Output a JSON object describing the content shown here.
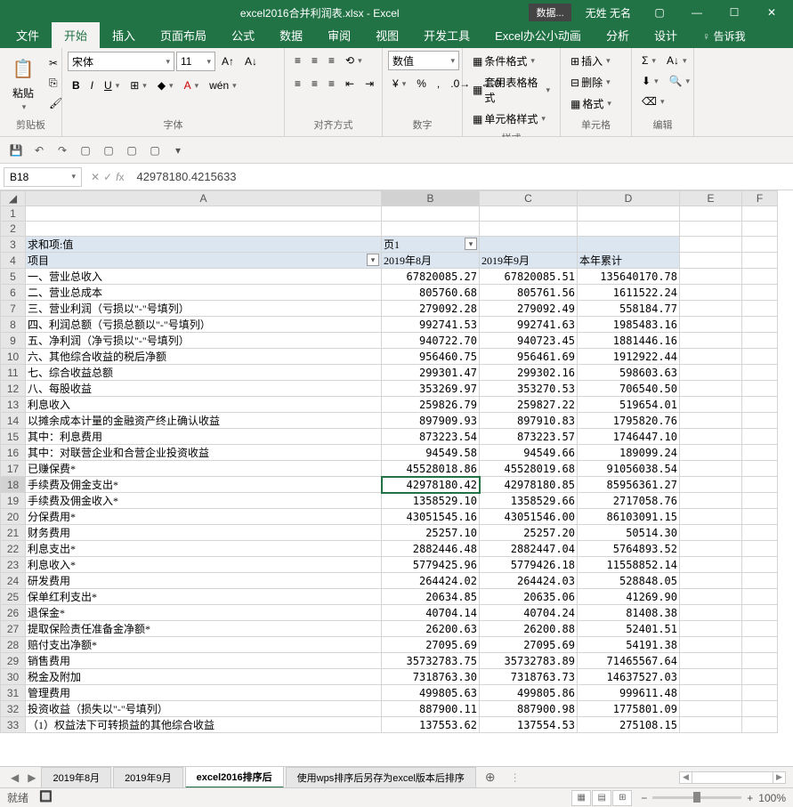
{
  "title_bar": {
    "filename": "excel2016合并利润表.xlsx - Excel",
    "data_label": "数据...",
    "user": "无姓 无名"
  },
  "menu": {
    "file": "文件",
    "home": "开始",
    "insert": "插入",
    "layout": "页面布局",
    "formula": "公式",
    "data": "数据",
    "review": "审阅",
    "view": "视图",
    "dev": "开发工具",
    "anim": "Excel办公小动画",
    "analyze": "分析",
    "design": "设计",
    "tell": "告诉我"
  },
  "ribbon": {
    "clipboard": {
      "label": "剪贴板",
      "paste": "粘贴"
    },
    "font": {
      "label": "字体",
      "name": "宋体",
      "size": "11"
    },
    "align": {
      "label": "对齐方式"
    },
    "number": {
      "label": "数字",
      "format": "数值"
    },
    "styles": {
      "label": "样式",
      "cond": "条件格式",
      "table": "套用表格格式",
      "cell": "单元格样式"
    },
    "cells": {
      "label": "单元格",
      "insert": "插入",
      "delete": "删除",
      "format": "格式"
    },
    "editing": {
      "label": "编辑"
    }
  },
  "name_box": "B18",
  "formula": "42978180.4215633",
  "cols": [
    "A",
    "B",
    "C",
    "D",
    "E",
    "F"
  ],
  "pivot": {
    "measure": "求和项:值",
    "page": "页1",
    "rowlabel": "项目",
    "col1": "2019年8月",
    "col2": "2019年9月",
    "col3": "本年累计"
  },
  "rows": [
    {
      "r": 5,
      "a": "一、营业总收入",
      "b": "67820085.27",
      "c": "67820085.51",
      "d": "135640170.78"
    },
    {
      "r": 6,
      "a": "二、营业总成本",
      "b": "805760.68",
      "c": "805761.56",
      "d": "1611522.24"
    },
    {
      "r": 7,
      "a": "三、营业利润（亏损以\"-\"号填列）",
      "b": "279092.28",
      "c": "279092.49",
      "d": "558184.77"
    },
    {
      "r": 8,
      "a": "四、利润总额（亏损总额以\"-\"号填列）",
      "b": "992741.53",
      "c": "992741.63",
      "d": "1985483.16"
    },
    {
      "r": 9,
      "a": "五、净利润（净亏损以\"-\"号填列）",
      "b": "940722.70",
      "c": "940723.45",
      "d": "1881446.16"
    },
    {
      "r": 10,
      "a": "六、其他综合收益的税后净额",
      "b": "956460.75",
      "c": "956461.69",
      "d": "1912922.44"
    },
    {
      "r": 11,
      "a": "七、综合收益总额",
      "b": "299301.47",
      "c": "299302.16",
      "d": "598603.63"
    },
    {
      "r": 12,
      "a": "八、每股收益",
      "b": "353269.97",
      "c": "353270.53",
      "d": "706540.50"
    },
    {
      "r": 13,
      "a": "                利息收入",
      "b": "259826.79",
      "c": "259827.22",
      "d": "519654.01"
    },
    {
      "r": 14,
      "a": "                以摊余成本计量的金融资产终止确认收益",
      "b": "897909.93",
      "c": "897910.83",
      "d": "1795820.76"
    },
    {
      "r": 15,
      "a": "          其中：利息费用",
      "b": "873223.54",
      "c": "873223.57",
      "d": "1746447.10"
    },
    {
      "r": 16,
      "a": "          其中：对联营企业和合营企业投资收益",
      "b": "94549.58",
      "c": "94549.66",
      "d": "189099.24"
    },
    {
      "r": 17,
      "a": "          已赚保费*",
      "b": "45528018.86",
      "c": "45528019.68",
      "d": "91056038.54"
    },
    {
      "r": 18,
      "a": "          手续费及佣金支出*",
      "b": "42978180.42",
      "c": "42978180.85",
      "d": "85956361.27",
      "sel": true
    },
    {
      "r": 19,
      "a": "          手续费及佣金收入*",
      "b": "1358529.10",
      "c": "1358529.66",
      "d": "2717058.76"
    },
    {
      "r": 20,
      "a": "          分保费用*",
      "b": "43051545.16",
      "c": "43051546.00",
      "d": "86103091.15"
    },
    {
      "r": 21,
      "a": "          财务费用",
      "b": "25257.10",
      "c": "25257.20",
      "d": "50514.30"
    },
    {
      "r": 22,
      "a": "          利息支出*",
      "b": "2882446.48",
      "c": "2882447.04",
      "d": "5764893.52"
    },
    {
      "r": 23,
      "a": "          利息收入*",
      "b": "5779425.96",
      "c": "5779426.18",
      "d": "11558852.14"
    },
    {
      "r": 24,
      "a": "          研发费用",
      "b": "264424.02",
      "c": "264424.03",
      "d": "528848.05"
    },
    {
      "r": 25,
      "a": "          保单红利支出*",
      "b": "20634.85",
      "c": "20635.06",
      "d": "41269.90"
    },
    {
      "r": 26,
      "a": "          退保金*",
      "b": "40704.14",
      "c": "40704.24",
      "d": "81408.38"
    },
    {
      "r": 27,
      "a": "          提取保险责任准备金净额*",
      "b": "26200.63",
      "c": "26200.88",
      "d": "52401.51"
    },
    {
      "r": 28,
      "a": "          赔付支出净额*",
      "b": "27095.69",
      "c": "27095.69",
      "d": "54191.38"
    },
    {
      "r": 29,
      "a": "          销售费用",
      "b": "35732783.75",
      "c": "35732783.89",
      "d": "71465567.64"
    },
    {
      "r": 30,
      "a": "          税金及附加",
      "b": "7318763.30",
      "c": "7318763.73",
      "d": "14637527.03"
    },
    {
      "r": 31,
      "a": "          管理费用",
      "b": "499805.63",
      "c": "499805.86",
      "d": "999611.48"
    },
    {
      "r": 32,
      "a": "      投资收益（损失以\"-\"号填列）",
      "b": "887900.11",
      "c": "887900.98",
      "d": "1775801.09"
    },
    {
      "r": 33,
      "a": "    （1）权益法下可转损益的其他综合收益",
      "b": "137553.62",
      "c": "137554.53",
      "d": "275108.15"
    }
  ],
  "sheets": {
    "s1": "2019年8月",
    "s2": "2019年9月",
    "s3": "excel2016排序后",
    "s4": "使用wps排序后另存为excel版本后排序"
  },
  "status": {
    "ready": "就绪",
    "acc": "",
    "zoom": "100%"
  }
}
